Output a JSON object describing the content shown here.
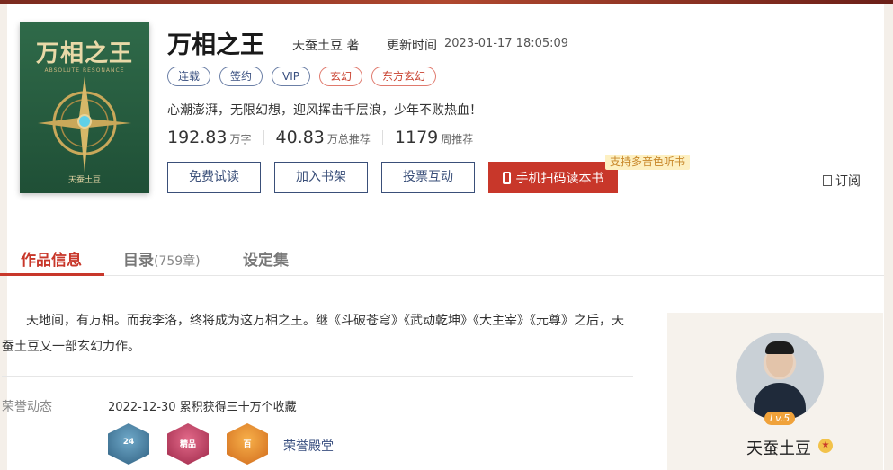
{
  "cover": {
    "title": "万相之王",
    "subtitle": "ABSOLUTE RESONANCE",
    "author": "天蚕土豆"
  },
  "book": {
    "title": "万相之王",
    "author": "天蚕土豆 著",
    "update_label": "更新时间",
    "update_time": "2023-01-17 18:05:09",
    "tags": [
      {
        "label": "连载",
        "style": "blue"
      },
      {
        "label": "签约",
        "style": "blue"
      },
      {
        "label": "VIP",
        "style": "blue"
      },
      {
        "label": "玄幻",
        "style": "red"
      },
      {
        "label": "东方玄幻",
        "style": "red"
      }
    ],
    "intro": "心潮澎湃，无限幻想，迎风挥击千层浪，少年不败热血！",
    "stats": [
      {
        "num": "192.83",
        "unit": "万字"
      },
      {
        "num": "40.83",
        "unit": "万总推荐"
      },
      {
        "num": "1179",
        "unit": "周推荐"
      }
    ]
  },
  "actions": {
    "free_read": "免费试读",
    "add_shelf": "加入书架",
    "vote": "投票互动",
    "phone_read": "手机扫码读本书",
    "audio_badge": "支持多音色听书",
    "subscribe": "订阅"
  },
  "tabs": {
    "info": "作品信息",
    "catalog": "目录",
    "catalog_count": "(759章)",
    "settings": "设定集"
  },
  "description": "天地间，有万相。而我李洛，终将成为这万相之王。继《斗破苍穹》《武动乾坤》《大主宰》《元尊》之后，天蚕土豆又一部玄幻力作。",
  "honor": {
    "label": "荣誉动态",
    "text": "2022-12-30 累积获得三十万个收藏",
    "medals": [
      "24",
      "精品",
      "百"
    ],
    "link": "荣誉殿堂"
  },
  "author_panel": {
    "name": "天蚕土豆",
    "level": "Lv.5"
  },
  "colors": {
    "accent_red": "#c8372a",
    "navy": "#3a4f79"
  }
}
